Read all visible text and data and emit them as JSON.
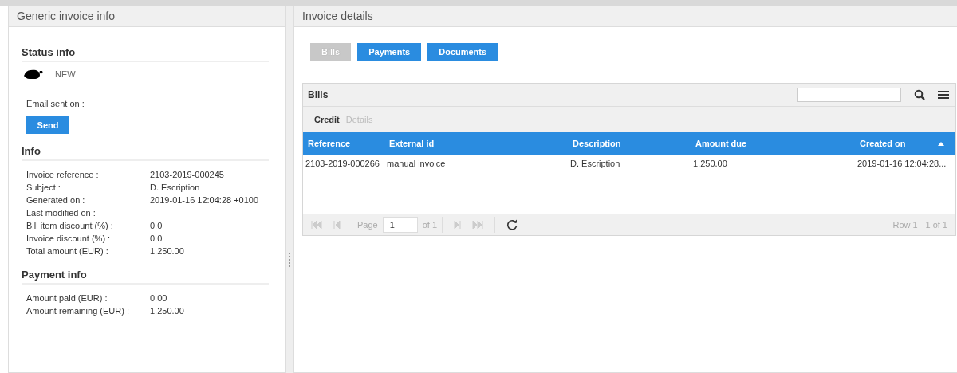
{
  "left_panel": {
    "title": "Generic invoice info",
    "status": {
      "heading": "Status info",
      "value": "NEW",
      "email_label": "Email sent on :",
      "send_button": "Send"
    },
    "info": {
      "heading": "Info",
      "fields": [
        {
          "label": "Invoice reference :",
          "value": "2103-2019-000245"
        },
        {
          "label": "Subject :",
          "value": "D. Escription"
        },
        {
          "label": "Generated on  :",
          "value": "2019-01-16 12:04:28 +0100"
        },
        {
          "label": "Last modified on :"
        },
        {
          "label": "Bill item discount (%) :",
          "value": "0.0"
        },
        {
          "label": "Invoice discount (%) :",
          "value": "0.0"
        },
        {
          "label": "Total amount (EUR) :",
          "value": "1,250.00"
        }
      ]
    },
    "payment": {
      "heading": "Payment info",
      "fields": [
        {
          "label": "Amount paid (EUR) :",
          "value": "0.00"
        },
        {
          "label": "Amount remaining (EUR) :",
          "value": "1,250.00"
        }
      ]
    }
  },
  "right_panel": {
    "title": "Invoice details",
    "buttons": [
      {
        "label": "Bills",
        "selected": true
      },
      {
        "label": "Payments",
        "selected": false
      },
      {
        "label": "Documents",
        "selected": false
      }
    ],
    "grid": {
      "title": "Bills",
      "tabs": [
        {
          "label": "Credit",
          "selected": true
        },
        {
          "label": "Details",
          "selected": false
        }
      ],
      "columns": [
        "Reference",
        "External id",
        "Description",
        "Amount due",
        "Created on"
      ],
      "rows": [
        [
          "2103-2019-000266",
          "manual invoice",
          "D. Escription",
          "1,250.00",
          "2019-01-16 12:04:28..."
        ]
      ],
      "pager": {
        "page_label": "Page",
        "page": "1",
        "of": "of 1",
        "summary": "Row 1 - 1 of 1"
      }
    }
  }
}
